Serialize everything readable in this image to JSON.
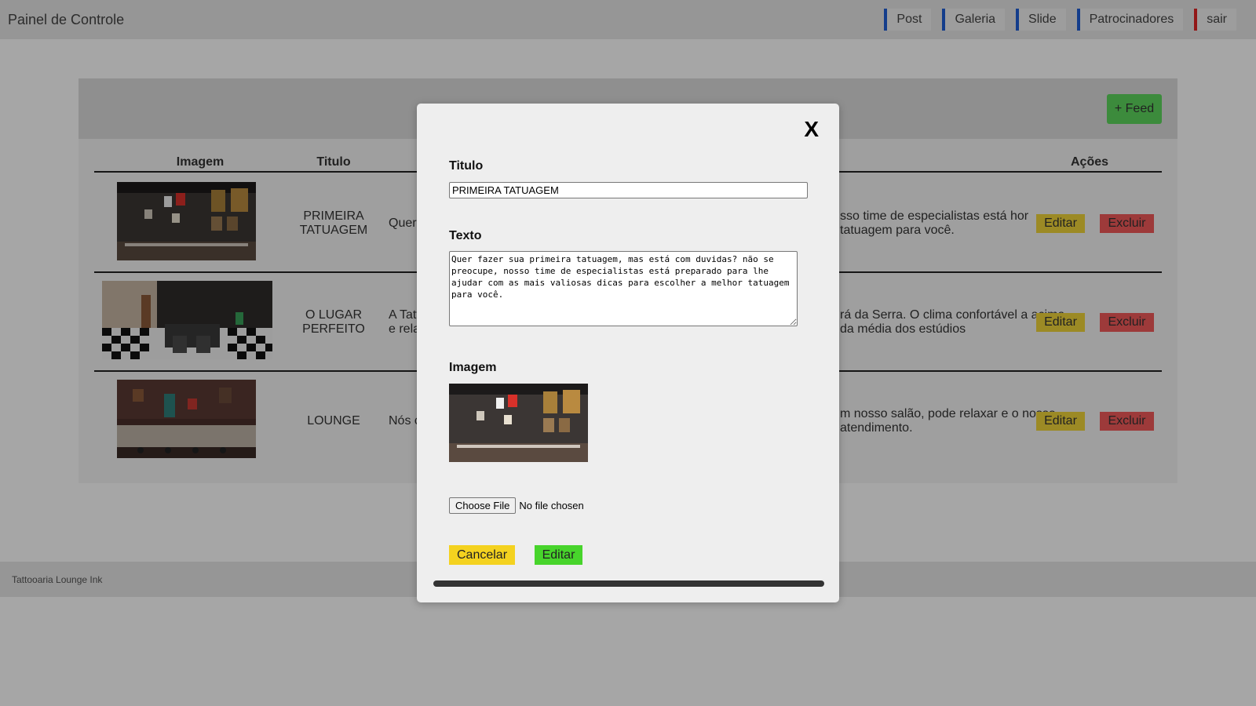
{
  "header": {
    "brand": "Painel de Controle",
    "nav": [
      {
        "label": "Post"
      },
      {
        "label": "Galeria"
      },
      {
        "label": "Slide"
      },
      {
        "label": "Patrocinadores"
      },
      {
        "label": "sair"
      }
    ]
  },
  "panel": {
    "add_label": "+ Feed",
    "columns": {
      "image": "Imagem",
      "title": "Titulo",
      "actions": "Ações"
    },
    "rows": [
      {
        "title": "PRIMEIRA TATUAGEM",
        "text_left": "Quer",
        "text_right": "sso time de especialistas está hor tatuagem para você."
      },
      {
        "title": "O LUGAR PERFEITO",
        "text_left": "A Tatto e relax",
        "text_right": "rá da Serra. O clima confortável a acima da média dos estúdios"
      },
      {
        "title": "LOUNGE",
        "text_left": "Nós c",
        "text_right": "m nosso salão, pode relaxar e o nosso atendimento."
      }
    ],
    "edit_label": "Editar",
    "delete_label": "Excluir"
  },
  "footer": {
    "text": "Tattooaria Lounge Ink"
  },
  "modal": {
    "close": "X",
    "title_label": "Titulo",
    "title_value": "PRIMEIRA TATUAGEM",
    "text_label": "Texto",
    "text_value": "Quer fazer sua primeira tatuagem, mas está com duvidas? não se preocupe, nosso time de especialistas está preparado para lhe ajudar com as mais valiosas dicas para escolher a melhor tatuagem para você.",
    "image_label": "Imagem",
    "file_button": "Choose File",
    "file_status": "No file chosen",
    "cancel_label": "Cancelar",
    "save_label": "Editar"
  },
  "colors": {
    "nav_accent": "#1f5fd6",
    "nav_danger": "#e02424",
    "add_button": "#5cd65c",
    "edit_button": "#f0d43a",
    "delete_button": "#f25a5a",
    "cancel_button": "#f4d21f",
    "save_button": "#47d42b"
  }
}
